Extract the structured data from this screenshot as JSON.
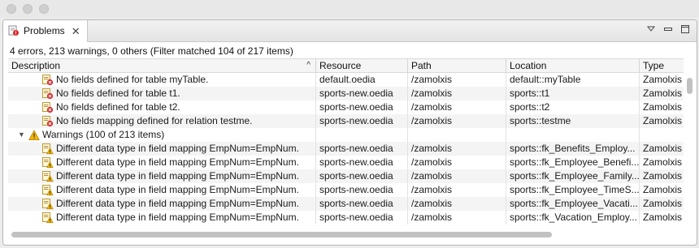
{
  "view": {
    "tab_label": "Problems",
    "summary": "4 errors, 213 warnings, 0 others (Filter matched 104 of 217 items)"
  },
  "columns": [
    "Description",
    "Resource",
    "Path",
    "Location",
    "Type"
  ],
  "rows": [
    {
      "kind": "error",
      "description": "No fields defined for table myTable.",
      "resource": "default.oedia",
      "path": "/zamolxis",
      "location": "default::myTable",
      "type": "Zamolxis"
    },
    {
      "kind": "error",
      "description": "No fields defined for table t1.",
      "resource": "sports-new.oedia",
      "path": "/zamolxis",
      "location": "sports::t1",
      "type": "Zamolxis"
    },
    {
      "kind": "error",
      "description": "No fields defined for table t2.",
      "resource": "sports-new.oedia",
      "path": "/zamolxis",
      "location": "sports::t2",
      "type": "Zamolxis"
    },
    {
      "kind": "error",
      "description": "No fields mapping defined for relation testme.",
      "resource": "sports-new.oedia",
      "path": "/zamolxis",
      "location": "sports::testme",
      "type": "Zamolxis"
    },
    {
      "kind": "group",
      "description": "Warnings (100 of 213 items)",
      "resource": "",
      "path": "",
      "location": "",
      "type": ""
    },
    {
      "kind": "warning",
      "description": "Different data type in field mapping EmpNum=EmpNum.",
      "resource": "sports-new.oedia",
      "path": "/zamolxis",
      "location": "sports::fk_Benefits_Employ...",
      "type": "Zamolxis"
    },
    {
      "kind": "warning",
      "description": "Different data type in field mapping EmpNum=EmpNum.",
      "resource": "sports-new.oedia",
      "path": "/zamolxis",
      "location": "sports::fk_Employee_Benefi...",
      "type": "Zamolxis"
    },
    {
      "kind": "warning",
      "description": "Different data type in field mapping EmpNum=EmpNum.",
      "resource": "sports-new.oedia",
      "path": "/zamolxis",
      "location": "sports::fk_Employee_Family...",
      "type": "Zamolxis"
    },
    {
      "kind": "warning",
      "description": "Different data type in field mapping EmpNum=EmpNum.",
      "resource": "sports-new.oedia",
      "path": "/zamolxis",
      "location": "sports::fk_Employee_TimeS...",
      "type": "Zamolxis"
    },
    {
      "kind": "warning",
      "description": "Different data type in field mapping EmpNum=EmpNum.",
      "resource": "sports-new.oedia",
      "path": "/zamolxis",
      "location": "sports::fk_Employee_Vacati...",
      "type": "Zamolxis"
    },
    {
      "kind": "warning",
      "description": "Different data type in field mapping EmpNum=EmpNum.",
      "resource": "sports-new.oedia",
      "path": "/zamolxis",
      "location": "sports::fk_Vacation_Employ...",
      "type": "Zamolxis"
    }
  ],
  "icons": {
    "tab": "problems-view-icon",
    "error": "error-marker-icon",
    "warning": "warning-marker-icon",
    "group": "warning-group-icon",
    "view_menu": "view-menu-chevron-icon",
    "minimize": "minimize-icon",
    "maximize": "maximize-icon",
    "close": "close-icon"
  },
  "colors": {
    "error": "#d9262a",
    "warning": "#f2b705"
  }
}
